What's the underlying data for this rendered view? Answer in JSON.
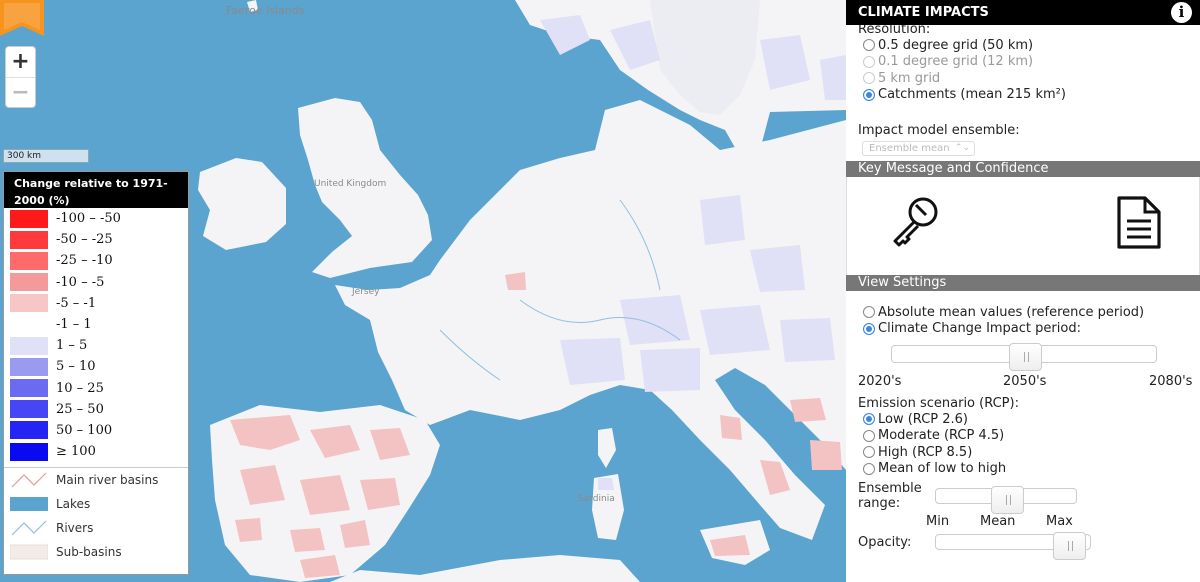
{
  "map": {
    "place_labels": [
      "Faeroe Islands",
      "United Kingdom",
      "Jersey",
      "Sardinia"
    ],
    "zoom_in": "+",
    "zoom_out": "−",
    "scale": "300 km"
  },
  "legend": {
    "title": "Change relative to 1971-2000 (%)",
    "classes": [
      {
        "label": "-100 – -50",
        "color": "#ff1a1a"
      },
      {
        "label": "-50 – -25",
        "color": "#ff3a3a"
      },
      {
        "label": "-25 – -10",
        "color": "#ff6b6b"
      },
      {
        "label": "-10 – -5",
        "color": "#f59a9a"
      },
      {
        "label": "-5 – -1",
        "color": "#f7c6c6"
      },
      {
        "label": "-1 – 1",
        "color": "#ffffff"
      },
      {
        "label": "1 – 5",
        "color": "#e0e0f6"
      },
      {
        "label": "5 – 10",
        "color": "#9a9af0"
      },
      {
        "label": "10 – 25",
        "color": "#6b6bf2"
      },
      {
        "label": "25 – 50",
        "color": "#4646f6"
      },
      {
        "label": "50 – 100",
        "color": "#2424f4"
      },
      {
        "label": "≥ 100",
        "color": "#0a0af0"
      }
    ],
    "layers": [
      {
        "label": "Main river basins",
        "icon": "river-basin-line-icon"
      },
      {
        "label": "Lakes",
        "icon": "lake-swatch-icon"
      },
      {
        "label": "Rivers",
        "icon": "river-line-icon"
      },
      {
        "label": "Sub-basins",
        "icon": "sub-basin-swatch-icon"
      }
    ]
  },
  "panel": {
    "title": "CLIMATE IMPACTS",
    "info": "i",
    "resolution_label": "Resolution:",
    "resolution_options": [
      {
        "label": "0.5 degree grid (50 km)",
        "state": "unchecked"
      },
      {
        "label": "0.1 degree grid (12 km)",
        "state": "disabled"
      },
      {
        "label": "5 km grid",
        "state": "disabled"
      },
      {
        "label": "Catchments (mean 215 km²)",
        "state": "checked"
      }
    ],
    "ensemble_label": "Impact model ensemble:",
    "ensemble_select": "Ensemble mean",
    "key_message_header": "Key Message and Confidence",
    "key_icon": "key-icon",
    "document_icon": "document-icon",
    "view_settings_header": "View Settings",
    "view_options": [
      {
        "label": "Absolute mean values (reference period)",
        "state": "unchecked"
      },
      {
        "label": "Climate Change Impact period:",
        "state": "checked"
      }
    ],
    "period_ticks": [
      "2020's",
      "2050's",
      "2080's"
    ],
    "period_value": "2050's",
    "scenario_label": "Emission scenario (RCP):",
    "scenario_options": [
      {
        "label": "Low (RCP 2.6)",
        "state": "checked"
      },
      {
        "label": "Moderate (RCP 4.5)",
        "state": "unchecked"
      },
      {
        "label": "High (RCP 8.5)",
        "state": "unchecked"
      },
      {
        "label": "Mean of low to high",
        "state": "unchecked"
      }
    ],
    "ensemble_range_label_1": "Ensemble",
    "ensemble_range_label_2": "range:",
    "ensemble_ticks": [
      "Min",
      "Mean",
      "Max"
    ],
    "ensemble_value": "Mean",
    "opacity_label": "Opacity:",
    "opacity_level": 1.0
  }
}
